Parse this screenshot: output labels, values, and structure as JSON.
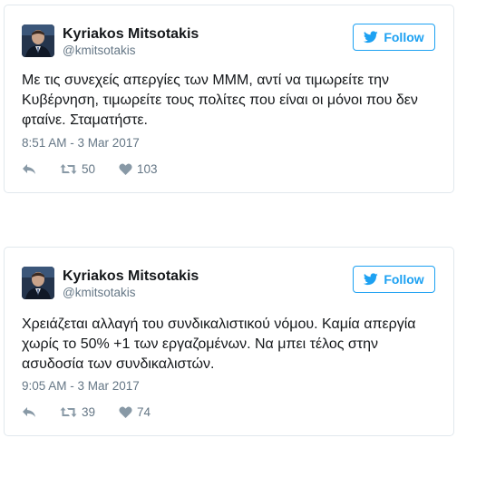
{
  "colors": {
    "accent": "#1da1f2",
    "secondary_text": "#657786",
    "primary_text": "#14171a",
    "border": "#e1e8ed"
  },
  "tweets": [
    {
      "author_name": "Kyriakos Mitsotakis",
      "handle": "@kmitsotakis",
      "follow_label": "Follow",
      "text": "Με τις συνεχείς απεργίες των ΜΜΜ, αντί να τιμωρείτε την Κυβέρνηση, τιμωρείτε τους πολίτες που είναι οι μόνοι που δεν φταίνε. Σταματήστε.",
      "timestamp": "8:51 AM - 3 Mar 2017",
      "retweets": "50",
      "likes": "103"
    },
    {
      "author_name": "Kyriakos Mitsotakis",
      "handle": "@kmitsotakis",
      "follow_label": "Follow",
      "text": "Χρειάζεται αλλαγή του συνδικαλιστικού νόμου. Καμία απεργία χωρίς το 50% +1 των εργαζομένων. Να μπει τέλος στην ασυδοσία των συνδικαλιστών.",
      "timestamp": "9:05 AM - 3 Mar 2017",
      "retweets": "39",
      "likes": "74"
    }
  ]
}
